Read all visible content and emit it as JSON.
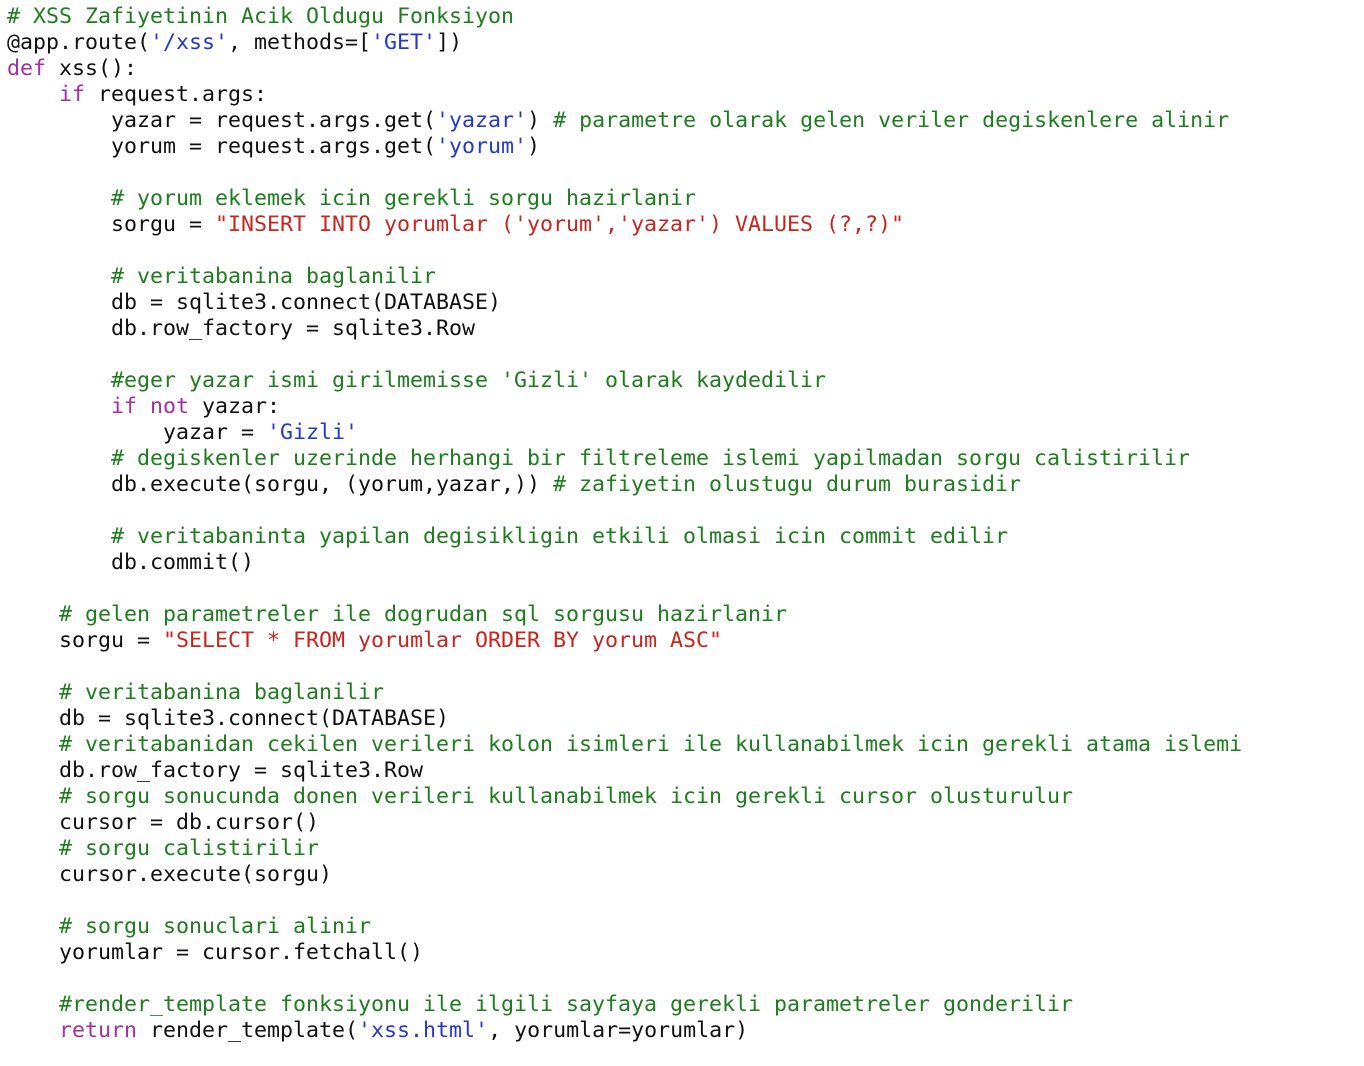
{
  "colors": {
    "background": "#ffffff",
    "comment": "#1e7d1e",
    "keyword": "#a52ea5",
    "string_single": "#2438c9",
    "string_double": "#c8251c",
    "plain": "#111111"
  },
  "code": {
    "lines": [
      [
        {
          "t": "comment",
          "v": "# XSS Zafiyetinin Acik Oldugu Fonksiyon"
        }
      ],
      [
        {
          "t": "plain",
          "v": "@app.route("
        },
        {
          "t": "string-single",
          "v": "'/xss'"
        },
        {
          "t": "plain",
          "v": ", methods=["
        },
        {
          "t": "string-single",
          "v": "'GET'"
        },
        {
          "t": "plain",
          "v": "])"
        }
      ],
      [
        {
          "t": "keyword",
          "v": "def"
        },
        {
          "t": "plain",
          "v": " xss():"
        }
      ],
      [
        {
          "t": "plain",
          "v": "    "
        },
        {
          "t": "keyword",
          "v": "if"
        },
        {
          "t": "plain",
          "v": " request.args:"
        }
      ],
      [
        {
          "t": "plain",
          "v": "        yazar = request.args.get("
        },
        {
          "t": "string-single",
          "v": "'yazar'"
        },
        {
          "t": "plain",
          "v": ") "
        },
        {
          "t": "comment",
          "v": "# parametre olarak gelen veriler degiskenlere alinir"
        }
      ],
      [
        {
          "t": "plain",
          "v": "        yorum = request.args.get("
        },
        {
          "t": "string-single",
          "v": "'yorum'"
        },
        {
          "t": "plain",
          "v": ")"
        }
      ],
      [
        {
          "t": "plain",
          "v": ""
        }
      ],
      [
        {
          "t": "plain",
          "v": "        "
        },
        {
          "t": "comment",
          "v": "# yorum eklemek icin gerekli sorgu hazirlanir"
        }
      ],
      [
        {
          "t": "plain",
          "v": "        sorgu = "
        },
        {
          "t": "string-double",
          "v": "\"INSERT INTO yorumlar ('yorum','yazar') VALUES (?,?)\""
        }
      ],
      [
        {
          "t": "plain",
          "v": ""
        }
      ],
      [
        {
          "t": "plain",
          "v": "        "
        },
        {
          "t": "comment",
          "v": "# veritabanina baglanilir"
        }
      ],
      [
        {
          "t": "plain",
          "v": "        db = sqlite3.connect(DATABASE)"
        }
      ],
      [
        {
          "t": "plain",
          "v": "        db.row_factory = sqlite3.Row"
        }
      ],
      [
        {
          "t": "plain",
          "v": ""
        }
      ],
      [
        {
          "t": "plain",
          "v": "        "
        },
        {
          "t": "comment",
          "v": "#eger yazar ismi girilmemisse 'Gizli' olarak kaydedilir"
        }
      ],
      [
        {
          "t": "plain",
          "v": "        "
        },
        {
          "t": "keyword",
          "v": "if not"
        },
        {
          "t": "plain",
          "v": " yazar:"
        }
      ],
      [
        {
          "t": "plain",
          "v": "            yazar = "
        },
        {
          "t": "string-single",
          "v": "'Gizli'"
        }
      ],
      [
        {
          "t": "plain",
          "v": "        "
        },
        {
          "t": "comment",
          "v": "# degiskenler uzerinde herhangi bir filtreleme islemi yapilmadan sorgu calistirilir"
        }
      ],
      [
        {
          "t": "plain",
          "v": "        db.execute(sorgu, (yorum,yazar,)) "
        },
        {
          "t": "comment",
          "v": "# zafiyetin olustugu durum burasidir"
        }
      ],
      [
        {
          "t": "plain",
          "v": ""
        }
      ],
      [
        {
          "t": "plain",
          "v": "        "
        },
        {
          "t": "comment",
          "v": "# veritabaninta yapilan degisikligin etkili olmasi icin commit edilir"
        }
      ],
      [
        {
          "t": "plain",
          "v": "        db.commit()"
        }
      ],
      [
        {
          "t": "plain",
          "v": ""
        }
      ],
      [
        {
          "t": "plain",
          "v": "    "
        },
        {
          "t": "comment",
          "v": "# gelen parametreler ile dogrudan sql sorgusu hazirlanir"
        }
      ],
      [
        {
          "t": "plain",
          "v": "    sorgu = "
        },
        {
          "t": "string-double",
          "v": "\"SELECT * FROM yorumlar ORDER BY yorum ASC\""
        }
      ],
      [
        {
          "t": "plain",
          "v": ""
        }
      ],
      [
        {
          "t": "plain",
          "v": "    "
        },
        {
          "t": "comment",
          "v": "# veritabanina baglanilir"
        }
      ],
      [
        {
          "t": "plain",
          "v": "    db = sqlite3.connect(DATABASE)"
        }
      ],
      [
        {
          "t": "plain",
          "v": "    "
        },
        {
          "t": "comment",
          "v": "# veritabanidan cekilen verileri kolon isimleri ile kullanabilmek icin gerekli atama islemi"
        }
      ],
      [
        {
          "t": "plain",
          "v": "    db.row_factory = sqlite3.Row"
        }
      ],
      [
        {
          "t": "plain",
          "v": "    "
        },
        {
          "t": "comment",
          "v": "# sorgu sonucunda donen verileri kullanabilmek icin gerekli cursor olusturulur"
        }
      ],
      [
        {
          "t": "plain",
          "v": "    cursor = db.cursor()"
        }
      ],
      [
        {
          "t": "plain",
          "v": "    "
        },
        {
          "t": "comment",
          "v": "# sorgu calistirilir"
        }
      ],
      [
        {
          "t": "plain",
          "v": "    cursor.execute(sorgu)"
        }
      ],
      [
        {
          "t": "plain",
          "v": ""
        }
      ],
      [
        {
          "t": "plain",
          "v": "    "
        },
        {
          "t": "comment",
          "v": "# sorgu sonuclari alinir"
        }
      ],
      [
        {
          "t": "plain",
          "v": "    yorumlar = cursor.fetchall()"
        }
      ],
      [
        {
          "t": "plain",
          "v": ""
        }
      ],
      [
        {
          "t": "plain",
          "v": "    "
        },
        {
          "t": "comment",
          "v": "#render_template fonksiyonu ile ilgili sayfaya gerekli parametreler gonderilir"
        }
      ],
      [
        {
          "t": "plain",
          "v": "    "
        },
        {
          "t": "keyword",
          "v": "return"
        },
        {
          "t": "plain",
          "v": " render_template("
        },
        {
          "t": "string-single",
          "v": "'xss.html'"
        },
        {
          "t": "plain",
          "v": ", yorumlar=yorumlar)"
        }
      ]
    ]
  }
}
